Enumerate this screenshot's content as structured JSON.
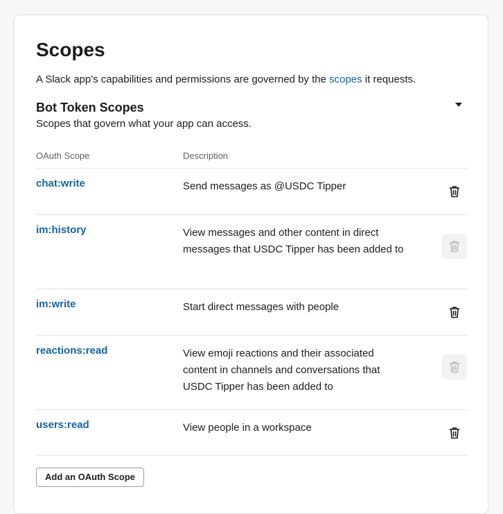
{
  "card": {
    "title": "Scopes",
    "intro_before": "A Slack app's capabilities and permissions are governed by the ",
    "intro_link": "scopes",
    "intro_after": " it requests."
  },
  "section": {
    "title": "Bot Token Scopes",
    "subtitle": "Scopes that govern what your app can access.",
    "collapse_icon": "caret-down-icon"
  },
  "columns": {
    "scope": "OAuth Scope",
    "description": "Description"
  },
  "scopes": [
    {
      "name": "chat:write",
      "description": "Send messages as @USDC Tipper",
      "delete_enabled": true
    },
    {
      "name": "im:history",
      "description": "View messages and other content in direct messages that USDC Tipper has been added to",
      "delete_enabled": false
    },
    {
      "name": "im:write",
      "description": "Start direct messages with people",
      "delete_enabled": true
    },
    {
      "name": "reactions:read",
      "description": "View emoji reactions and their associated content in channels and conversations that USDC Tipper has been added to",
      "delete_enabled": false
    },
    {
      "name": "users:read",
      "description": "View people in a workspace",
      "delete_enabled": true
    }
  ],
  "actions": {
    "add_scope_label": "Add an OAuth Scope"
  },
  "icons": {
    "delete": "trash-icon"
  },
  "colors": {
    "link": "#1264a3",
    "text": "#1d1c1d",
    "muted": "#616061",
    "disabled_icon": "#bbbbbb",
    "disabled_bg": "#f2f2f2"
  }
}
